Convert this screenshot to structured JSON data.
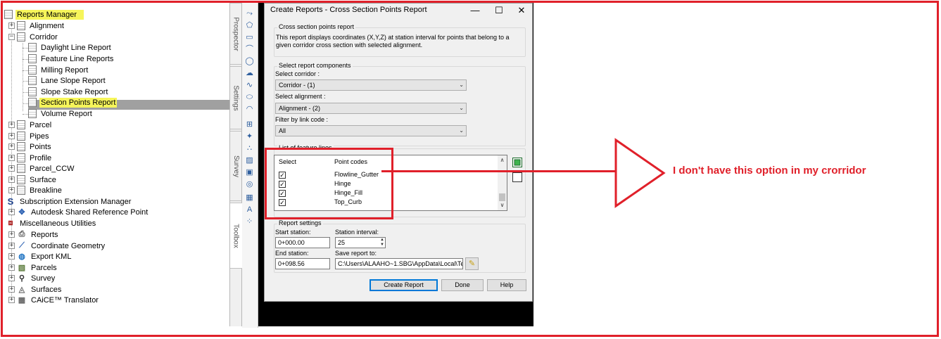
{
  "tree": {
    "items": [
      {
        "label": "Reports Manager"
      },
      {
        "label": "Alignment"
      },
      {
        "label": "Corridor"
      },
      {
        "label": "Daylight Line Report"
      },
      {
        "label": "Feature Line Reports"
      },
      {
        "label": "Milling Report"
      },
      {
        "label": "Lane Slope Report"
      },
      {
        "label": "Slope Stake Report"
      },
      {
        "label": "Section Points Report"
      },
      {
        "label": "Volume Report"
      },
      {
        "label": "Parcel"
      },
      {
        "label": "Pipes"
      },
      {
        "label": "Points"
      },
      {
        "label": "Profile"
      },
      {
        "label": "Parcel_CCW"
      },
      {
        "label": "Surface"
      },
      {
        "label": "Breakline"
      },
      {
        "label": "Subscription Extension Manager"
      },
      {
        "label": "Autodesk Shared Reference Point"
      },
      {
        "label": "Miscellaneous Utilities"
      },
      {
        "label": "Reports"
      },
      {
        "label": "Coordinate Geometry"
      },
      {
        "label": "Export KML"
      },
      {
        "label": "Parcels"
      },
      {
        "label": "Survey"
      },
      {
        "label": "Surfaces"
      },
      {
        "label": "CAiCE™ Translator"
      }
    ],
    "subscription_icon_glyph": "S"
  },
  "palette_tabs": {
    "prospector": "Prospector",
    "settings": "Settings",
    "survey": "Survey",
    "toolbox": "Toolbox"
  },
  "dialog": {
    "title": "Create Reports - Cross Section Points Report",
    "minimize": "—",
    "maximize": "☐",
    "close": "✕",
    "desc_group_title": "Cross section points report",
    "description": "This report displays coordinates (X,Y,Z) at station interval for points that belong to a given corridor cross section with selected alignment.",
    "components_title": "Select report components",
    "select_corridor_label": "Select corridor :",
    "corridor_value": "Corridor - (1)",
    "select_alignment_label": "Select alignment :",
    "alignment_value": "Alignment - (2)",
    "filter_label": "Filter by link code :",
    "filter_value": "All",
    "feature_lines_title": "List of feature lines",
    "col_select": "Select",
    "col_point_codes": "Point codes",
    "rows": [
      {
        "code": "Flowline_Gutter",
        "checked": "✓"
      },
      {
        "code": "Hinge",
        "checked": "✓"
      },
      {
        "code": "Hinge_Fill",
        "checked": "✓"
      },
      {
        "code": "Top_Curb",
        "checked": "✓"
      }
    ],
    "settings_title": "Report settings",
    "start_station_label": "Start station:",
    "start_station_value": "0+000.00",
    "station_interval_label": "Station interval:",
    "station_interval_value": "25",
    "end_station_label": "End station:",
    "end_station_value": "0+098.56",
    "save_report_label": "Save report to:",
    "save_report_value": "C:\\Users\\ALAAHO~1.SBG\\AppData\\Local\\Te",
    "btn_create": "Create Report",
    "btn_done": "Done",
    "btn_help": "Help"
  },
  "annotation": {
    "text": "I don't have this option in my crorridor",
    "color": "#e0202a"
  },
  "colors": {
    "highlight": "#f6f55a",
    "selection": "#a0a0a0",
    "accent": "#0078d7"
  }
}
